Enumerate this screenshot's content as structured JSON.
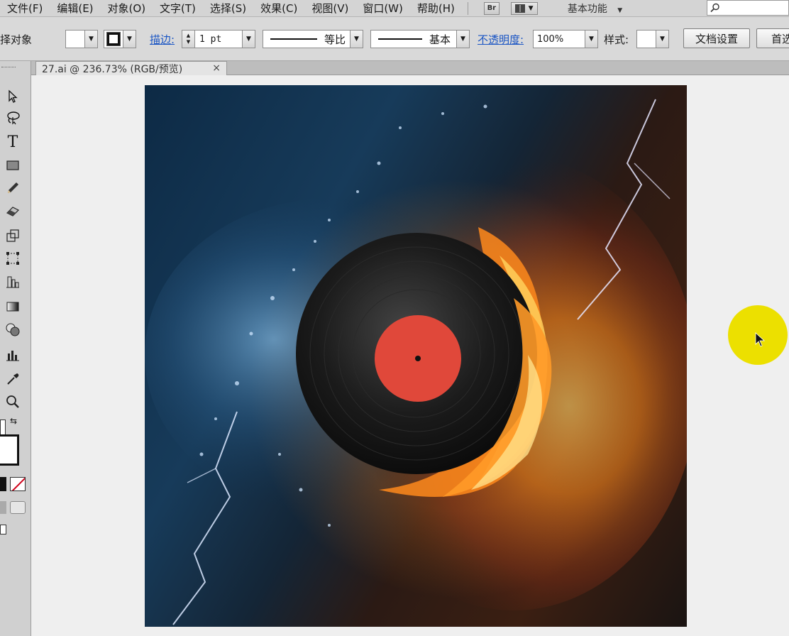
{
  "menubar": {
    "items": [
      "文件(F)",
      "编辑(E)",
      "对象(O)",
      "文字(T)",
      "选择(S)",
      "效果(C)",
      "视图(V)",
      "窗口(W)",
      "帮助(H)"
    ],
    "bridge_label": "Br",
    "workspace_label": "基本功能",
    "search_placeholder": ""
  },
  "controlbar": {
    "selection_label": "择对象",
    "stroke_label": "描边:",
    "stroke_weight": "1 pt",
    "stroke_profile_label": "等比",
    "brush_label": "基本",
    "opacity_label": "不透明度:",
    "opacity_value": "100%",
    "style_label": "样式:",
    "doc_setup_button": "文档设置",
    "prefs_button": "首选"
  },
  "document": {
    "tab_title": "27.ai @ 236.73% (RGB/预览)",
    "close_glyph": "×"
  },
  "toolbox": {
    "tools": [
      "selection-tool",
      "lasso-tool",
      "type-tool",
      "rectangle-tool",
      "pencil-tool",
      "eraser-tool",
      "scale-tool",
      "free-transform-tool",
      "symbol-sprayer-tool",
      "gradient-tool",
      "shape-builder-tool",
      "column-graph-tool",
      "eyedropper-tool",
      "zoom-tool"
    ],
    "type_glyph": "T"
  },
  "colors": {
    "accent_link": "#1a55c4",
    "cursor_highlight": "#ece000",
    "vinyl_label": "#e0483a"
  }
}
